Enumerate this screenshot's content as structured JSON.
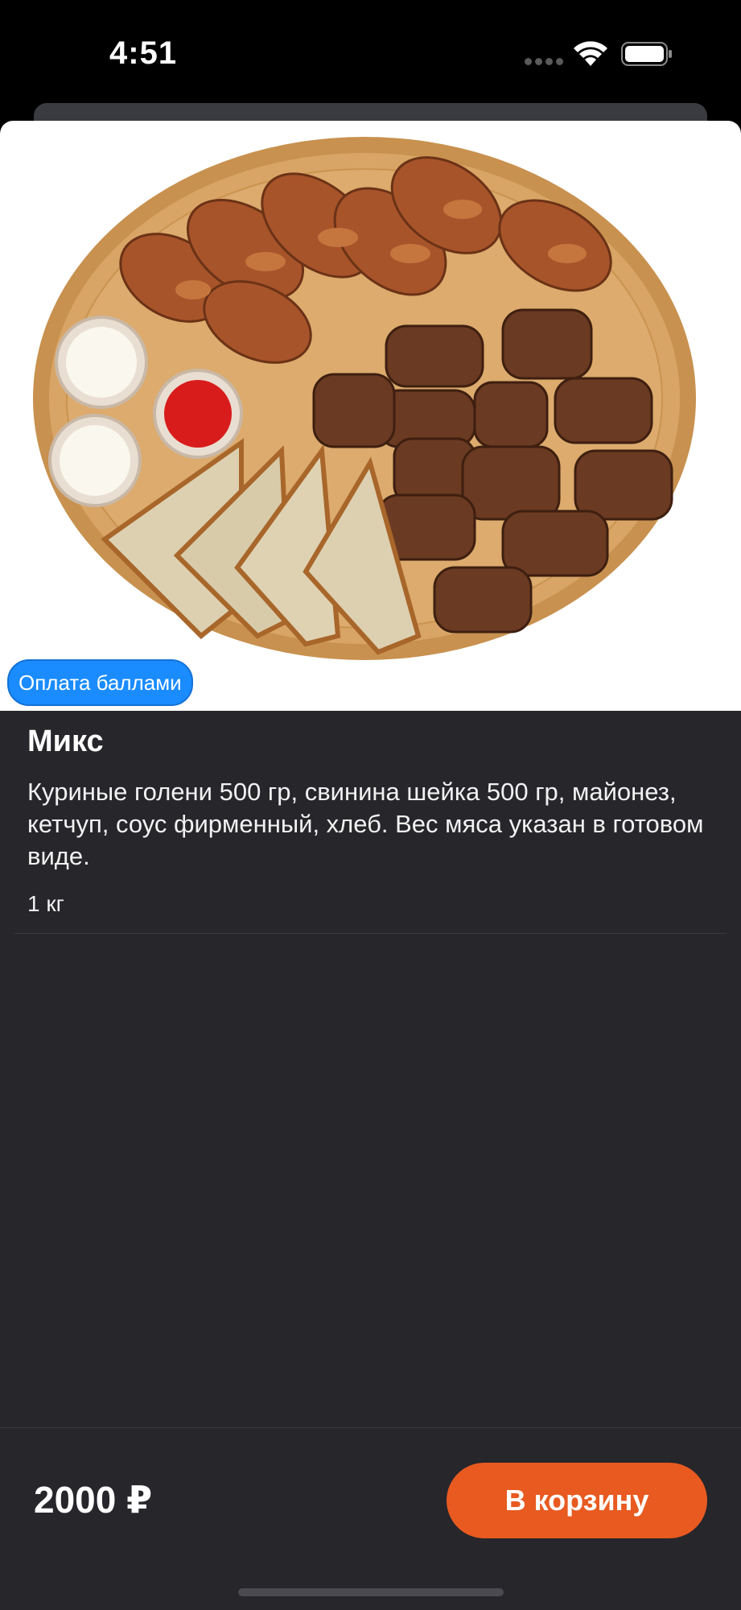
{
  "status_bar": {
    "time": "4:51"
  },
  "product": {
    "badge": "Оплата баллами",
    "title": "Микс",
    "description": "Куриные голени 500 гр, свинина шейка 500 гр, майонез, кетчуп, соус фирменный, хлеб. Вес мяса указан в готовом виде.",
    "weight": "1 кг",
    "image_icon": "food-platter-image"
  },
  "footer": {
    "price": "2000 ₽",
    "cart_button_label": "В корзину"
  },
  "colors": {
    "accent_orange": "#e85a20",
    "badge_blue": "#1a8cff",
    "sheet_background": "#26262b"
  }
}
